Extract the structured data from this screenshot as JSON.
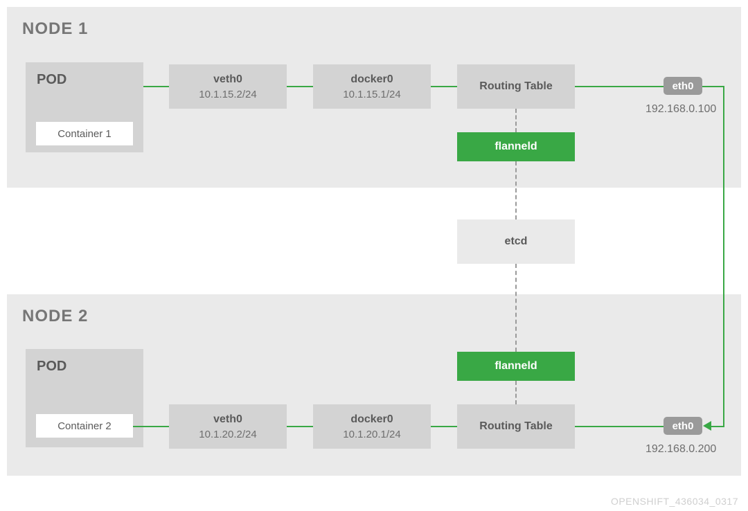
{
  "watermark": "OPENSHIFT_436034_0317",
  "node1": {
    "title": "NODE 1",
    "pod_label": "POD",
    "container": "Container 1",
    "veth": {
      "name": "veth0",
      "cidr": "10.1.15.2/24"
    },
    "docker": {
      "name": "docker0",
      "cidr": "10.1.15.1/24"
    },
    "routing": "Routing Table",
    "flanneld": "flanneld",
    "eth": {
      "name": "eth0",
      "ip": "192.168.0.100"
    }
  },
  "node2": {
    "title": "NODE 2",
    "pod_label": "POD",
    "container": "Container 2",
    "veth": {
      "name": "veth0",
      "cidr": "10.1.20.2/24"
    },
    "docker": {
      "name": "docker0",
      "cidr": "10.1.20.1/24"
    },
    "routing": "Routing Table",
    "flanneld": "flanneld",
    "eth": {
      "name": "eth0",
      "ip": "192.168.0.200"
    }
  },
  "etcd": "etcd"
}
